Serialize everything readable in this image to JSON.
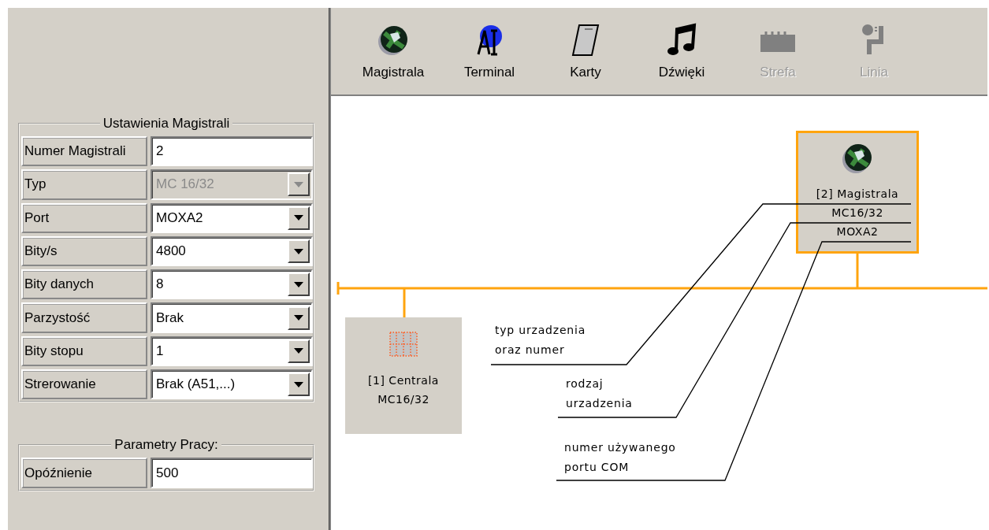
{
  "toolbar": {
    "buttons": [
      {
        "label": "Magistrala",
        "kind": "globe",
        "disabled": false
      },
      {
        "label": "Terminal",
        "kind": "terminal",
        "disabled": false
      },
      {
        "label": "Karty",
        "kind": "card",
        "disabled": false
      },
      {
        "label": "Dźwięki",
        "kind": "music",
        "disabled": false
      },
      {
        "label": "Strefa",
        "kind": "block",
        "disabled": true
      },
      {
        "label": "Linia",
        "kind": "pipe",
        "disabled": true
      }
    ]
  },
  "bus_settings": {
    "title": "Ustawienia Magistrali",
    "fields": [
      {
        "label": "Numer Magistrali",
        "kind": "text",
        "value": "2",
        "disabled": false
      },
      {
        "label": "Typ",
        "kind": "select",
        "value": "MC 16/32",
        "disabled": true
      },
      {
        "label": "Port",
        "kind": "select",
        "value": "MOXA2",
        "disabled": false
      },
      {
        "label": "Bity/s",
        "kind": "select",
        "value": "4800",
        "disabled": false
      },
      {
        "label": "Bity danych",
        "kind": "select",
        "value": "8",
        "disabled": false
      },
      {
        "label": "Parzystość",
        "kind": "select",
        "value": "Brak",
        "disabled": false
      },
      {
        "label": "Bity stopu",
        "kind": "select",
        "value": "1",
        "disabled": false
      },
      {
        "label": "Strerowanie",
        "kind": "select",
        "value": "Brak (A51,...)",
        "disabled": false
      }
    ]
  },
  "work_params": {
    "title": "Parametry Pracy:",
    "fields": [
      {
        "label": "Opóźnienie",
        "kind": "text",
        "value": "500",
        "disabled": false
      }
    ]
  },
  "diagram": {
    "nodes": [
      {
        "kind": "central",
        "selected": false,
        "lines": [
          "[1] Centrala",
          "MC16/32"
        ]
      },
      {
        "kind": "globe",
        "selected": true,
        "lines": [
          "[2] Magistrala",
          "MC16/32",
          "MOXA2"
        ]
      }
    ],
    "annotations": [
      {
        "lines": [
          "typ urzadzenia",
          "oraz numer"
        ]
      },
      {
        "lines": [
          "rodzaj",
          "urzadzenia"
        ]
      },
      {
        "lines": [
          "numer używanego",
          "portu COM"
        ]
      }
    ]
  }
}
